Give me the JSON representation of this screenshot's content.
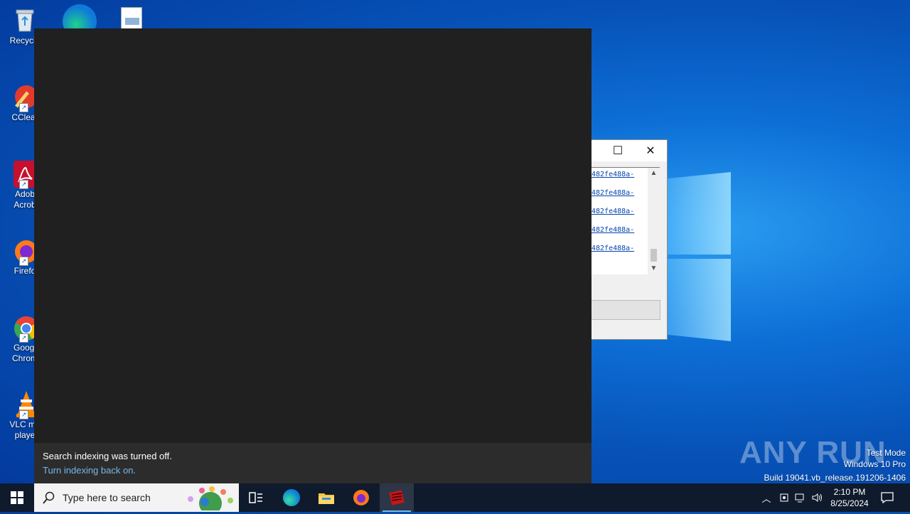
{
  "desktop": {
    "icons": [
      {
        "label": "Recycle",
        "icon": "recycle-bin-icon"
      },
      {
        "label": "CClear",
        "icon": "ccleaner-icon"
      },
      {
        "label": "Adob\nAcrob",
        "icon": "acrobat-icon"
      },
      {
        "label": "Firefo",
        "icon": "firefox-icon"
      },
      {
        "label": "Googl\nChrom",
        "icon": "chrome-icon"
      },
      {
        "label": "VLC me\nplaye",
        "icon": "vlc-icon"
      }
    ]
  },
  "dialog": {
    "links": [
      "482fe488a-",
      "482fe488a-",
      "482fe488a-",
      "482fe488a-",
      "482fe488a-"
    ],
    "maximize_glyph": "☐",
    "close_glyph": "✕"
  },
  "search_panel": {
    "notice": "Search indexing was turned off.",
    "link": "Turn indexing back on."
  },
  "watermark": {
    "brand": "ANY RUN",
    "line1": "Test Mode",
    "line2": "Windows 10 Pro",
    "line3": "Build 19041.vb_release.191206-1406"
  },
  "taskbar": {
    "search_placeholder": "Type here to search",
    "time": "2:10 PM",
    "date": "8/25/2024",
    "colors": {
      "bg": "#0f1a2c",
      "accent": "#76b9ed"
    }
  }
}
